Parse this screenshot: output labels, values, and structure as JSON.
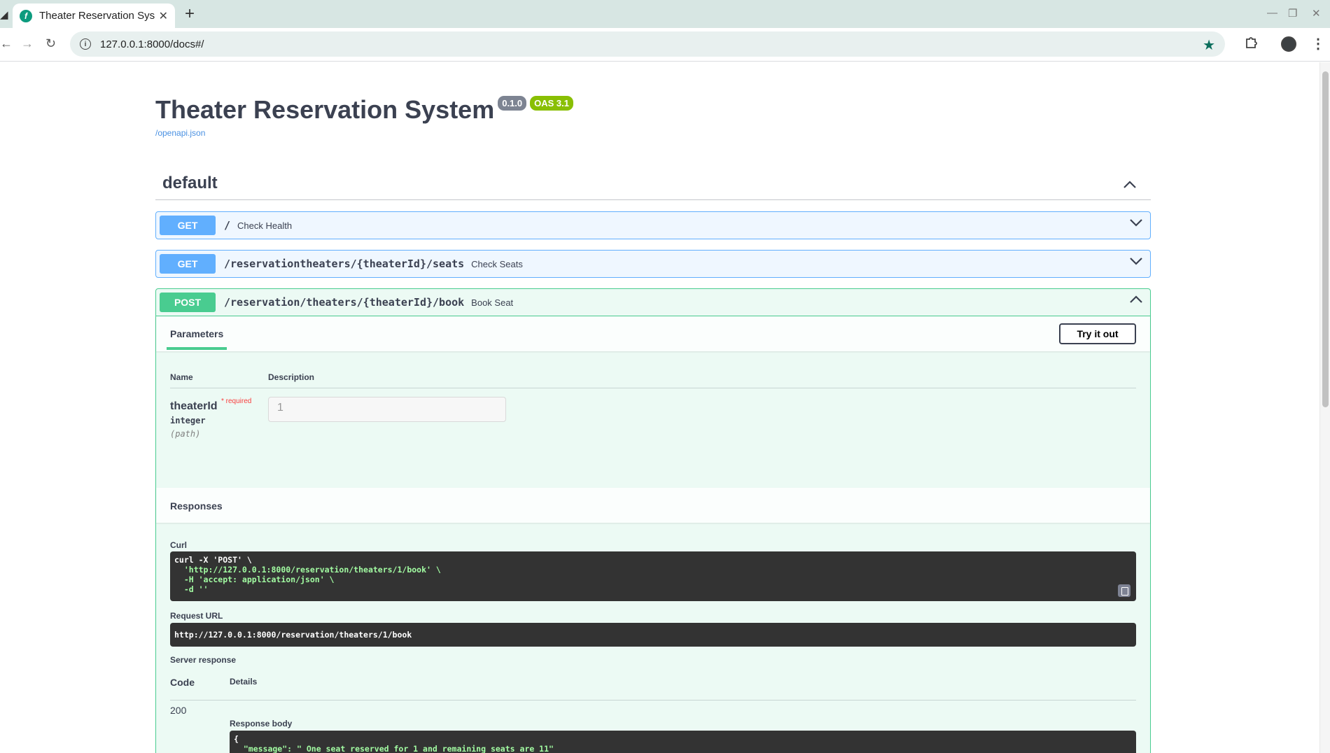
{
  "browser": {
    "tab_title": "Theater Reservation Sys",
    "favicon_letter": "f",
    "url": "127.0.0.1:8000/docs#/"
  },
  "header": {
    "title": "Theater Reservation System",
    "version_badge": "0.1.0",
    "oas_badge": "OAS 3.1",
    "spec_link": "/openapi.json"
  },
  "section": {
    "name": "default"
  },
  "operations": [
    {
      "method": "GET",
      "path": "/",
      "summary": "Check Health"
    },
    {
      "method": "GET",
      "path": "/reservationtheaters/{theaterId}/seats",
      "summary": "Check Seats"
    },
    {
      "method": "POST",
      "path": "/reservation/theaters/{theaterId}/book",
      "summary": "Book Seat"
    }
  ],
  "expanded": {
    "tab_label": "Parameters",
    "try_button": "Try it out",
    "col_name": "Name",
    "col_description": "Description",
    "param": {
      "name": "theaterId",
      "required": "* required",
      "type": "integer",
      "in": "(path)",
      "value": "1"
    },
    "responses_title": "Responses",
    "curl_label": "Curl",
    "curl_lines": [
      "curl -X 'POST' \\",
      "  'http://127.0.0.1:8000/reservation/theaters/1/book' \\",
      "  -H 'accept: application/json' \\",
      "  -d ''"
    ],
    "request_url_label": "Request URL",
    "request_url": "http://127.0.0.1:8000/reservation/theaters/1/book",
    "server_response_label": "Server response",
    "code_header": "Code",
    "details_header": "Details",
    "code": "200",
    "response_body_label": "Response body",
    "response_body_lines": [
      "{",
      "  \"message\": \" One seat reserved for 1 and remaining seats are 11\""
    ]
  },
  "colors": {
    "get": "#61affe",
    "post": "#49cc90",
    "title": "#3b4151",
    "link": "#4990e2"
  }
}
